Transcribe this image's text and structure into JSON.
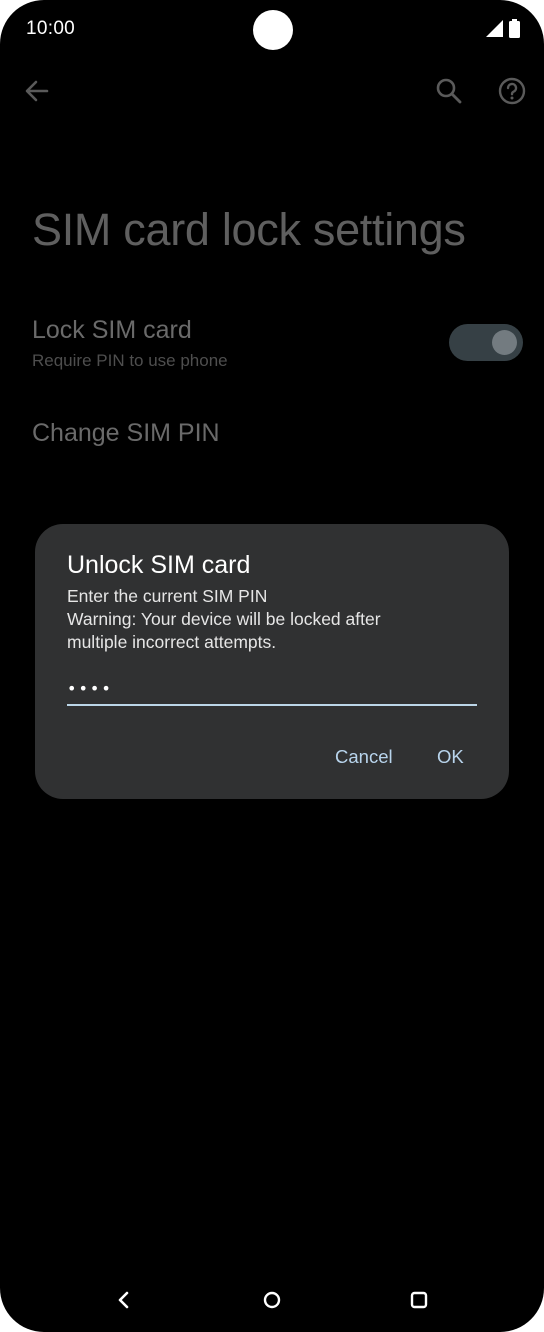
{
  "status_bar": {
    "time": "10:00",
    "icons": [
      "signal-icon",
      "battery-icon"
    ]
  },
  "app_bar": {
    "back_icon": "arrow-back-icon",
    "search_icon": "search-icon",
    "help_icon": "help-icon"
  },
  "page": {
    "title": "SIM card lock settings",
    "preferences": [
      {
        "title": "Lock SIM card",
        "summary": "Require PIN to use phone",
        "toggle_on": true
      },
      {
        "title": "Change SIM PIN"
      }
    ]
  },
  "dialog": {
    "title": "Unlock SIM card",
    "message_line1": "Enter the current SIM PIN",
    "message_line2": "Warning: Your device will be locked after",
    "message_line3": "multiple incorrect attempts.",
    "pin_value": "••••",
    "cancel_label": "Cancel",
    "ok_label": "OK"
  },
  "nav_bar": {
    "back_icon": "nav-back-icon",
    "home_icon": "nav-home-icon",
    "recents_icon": "nav-recents-icon"
  },
  "colors": {
    "background": "#000000",
    "dialog_surface": "#303132",
    "accent": "#b8d4ec",
    "dimmed_text": "#5f5f5f"
  }
}
